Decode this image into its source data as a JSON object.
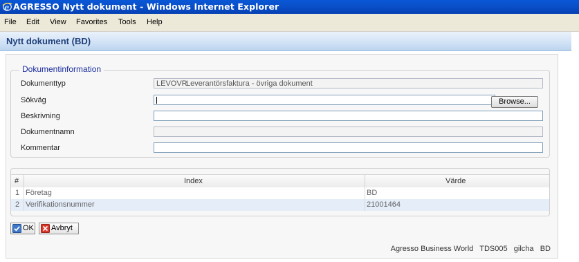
{
  "window": {
    "title": "AGRESSO Nytt dokument - Windows Internet Explorer",
    "icon": "ie-icon"
  },
  "menubar": {
    "items": [
      "File",
      "Edit",
      "View",
      "Favorites",
      "Tools",
      "Help"
    ]
  },
  "page": {
    "title": "Nytt dokument (BD)"
  },
  "docinfo": {
    "legend": "Dokumentinformation",
    "fields": {
      "dokumenttyp": {
        "label": "Dokumenttyp",
        "code": "LEVOVR",
        "value": "Leverantörsfaktura - övriga dokument"
      },
      "sokvag": {
        "label": "Sökväg",
        "value": ""
      },
      "beskrivning": {
        "label": "Beskrivning",
        "value": ""
      },
      "dokumentnamn": {
        "label": "Dokumentnamn",
        "value": ""
      },
      "kommentar": {
        "label": "Kommentar",
        "value": ""
      }
    },
    "browse_label": "Browse..."
  },
  "grid": {
    "columns": [
      "#",
      "Index",
      "Värde"
    ],
    "rows": [
      {
        "num": "1",
        "index": "Företag",
        "value": "BD"
      },
      {
        "num": "2",
        "index": "Verifikationsnummer",
        "value": "21001464"
      }
    ]
  },
  "actions": {
    "ok_label": "OK",
    "cancel_label": "Avbryt"
  },
  "status": {
    "app": "Agresso Business World",
    "server": "TDS005",
    "user": "gilcha",
    "company": "BD"
  },
  "colors": {
    "titlebar": "#0a4fc9",
    "header_text": "#1f3f7a",
    "legend_text": "#1b2e9e",
    "row_alt": "#e4edf8"
  }
}
